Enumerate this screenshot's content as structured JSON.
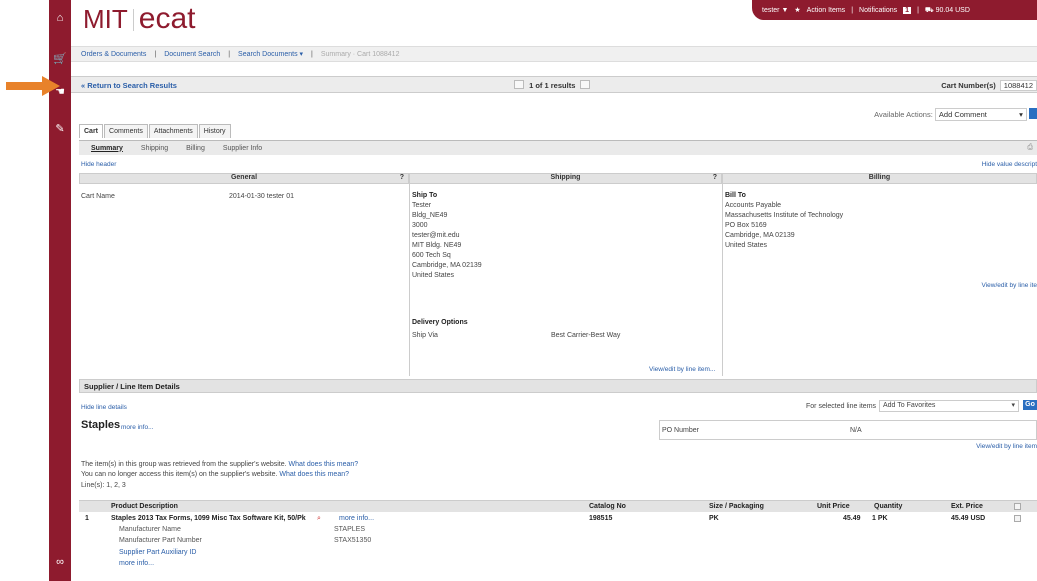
{
  "logo": {
    "mit": "MIT",
    "ecat": "ecat"
  },
  "topbar": {
    "user": "tester ▼",
    "action_items": "Action Items",
    "notifications": "Notifications",
    "notif_count": "1",
    "cart_total": "90.04 USD"
  },
  "breadcrumb": [
    "Orders & Documents",
    "Document Search",
    "Search Documents ▾",
    "Summary · Cart 1088412"
  ],
  "results": {
    "return": "Return to Search Results",
    "pager": "1 of 1 results",
    "cart_number_label": "Cart Number(s)",
    "cart_number": "1088412"
  },
  "available_actions": {
    "label": "Available Actions:",
    "value": "Add Comment"
  },
  "tabs": [
    "Cart",
    "Comments",
    "Attachments",
    "History"
  ],
  "subtabs": [
    "Summary",
    "Shipping",
    "Billing",
    "Supplier Info"
  ],
  "links": {
    "hide_header": "Hide header",
    "hide_value": "Hide value descript",
    "view_edit": "View/edit by line item...",
    "view_edit2": "View/edit by line ite",
    "hide_line": "Hide line details",
    "more_info": "more info...",
    "what_mean": "What does this mean?",
    "view_edit3": "View/edit by line item"
  },
  "general": {
    "title": "General",
    "q": "?",
    "cart_name_label": "Cart Name",
    "cart_name": "2014-01-30 tester 01"
  },
  "shipping": {
    "title": "Shipping",
    "q": "?",
    "ship_to": "Ship To",
    "lines": [
      "Tester",
      "Bldg_NE49",
      "3000",
      "tester@mit.edu",
      "MIT Bldg. NE49",
      "600 Tech Sq",
      "Cambridge, MA 02139",
      "United States"
    ],
    "delivery": "Delivery Options",
    "ship_via_label": "Ship Via",
    "ship_via": "Best Carrier-Best Way"
  },
  "billing": {
    "title": "Billing",
    "bill_to": "Bill To",
    "lines": [
      "Accounts Payable",
      "Massachusetts Institute of Technology",
      "PO Box 5169",
      "Cambridge, MA 02139",
      "United States"
    ]
  },
  "supplier": {
    "section": "Supplier / Line Item Details",
    "for_selected": "For selected line items",
    "selected_action": "Add To Favorites",
    "go": "Go",
    "name": "Staples",
    "po_label": "PO Number",
    "po_value": "N/A",
    "notice1": "The item(s) in this group was retrieved from the supplier's website.",
    "notice2": "You can no longer access this item(s) on the supplier's website.",
    "lines": "Line(s): 1, 2, 3"
  },
  "table": {
    "headers": [
      "Product Description",
      "Catalog No",
      "Size / Packaging",
      "Unit Price",
      "Quantity",
      "Ext. Price"
    ]
  },
  "item": {
    "num": "1",
    "desc": "Staples 2013 Tax Forms, 1099 Misc Tax Software Kit, 50/Pk",
    "catalog": "198515",
    "size": "PK",
    "unit": "45.49",
    "qty": "1 PK",
    "ext": "45.49 USD",
    "mfr_name_label": "Manufacturer Name",
    "mfr_name": "STAPLES",
    "mfr_part_label": "Manufacturer Part Number",
    "mfr_part": "STAX51350",
    "aux_label": "Supplier Part Auxiliary ID"
  },
  "colors": {
    "brand": "#8e1b2e",
    "link": "#2a5ea8",
    "arrow": "#e8822a"
  }
}
